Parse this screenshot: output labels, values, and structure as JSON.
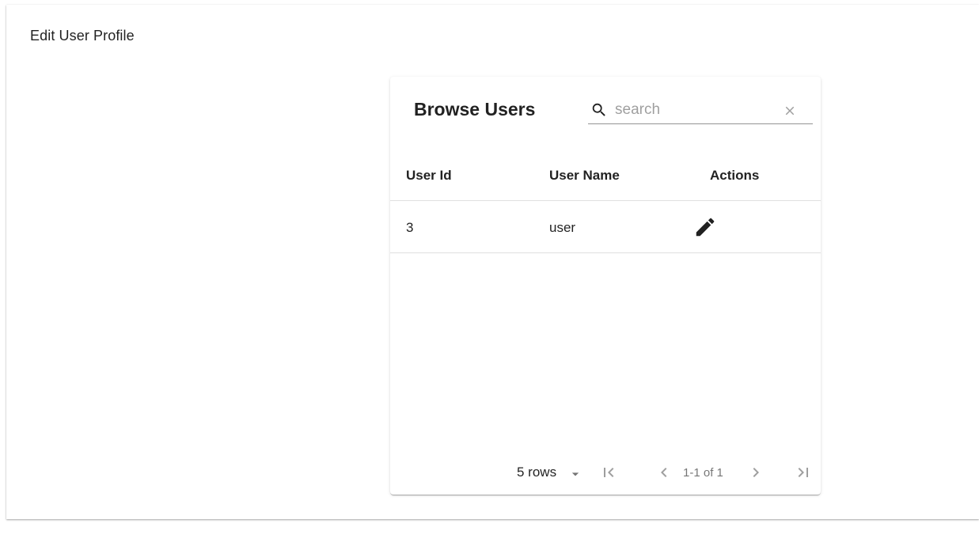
{
  "page": {
    "title": "Edit User Profile"
  },
  "table": {
    "title": "Browse Users",
    "search": {
      "placeholder": "search",
      "value": ""
    },
    "columns": [
      "User Id",
      "User Name",
      "Actions"
    ],
    "rows": [
      {
        "user_id": "3",
        "user_name": "user"
      }
    ],
    "pagination": {
      "rows_per_page": "5 rows",
      "range": "1-1 of 1"
    }
  },
  "icons": {
    "search": "search-icon",
    "clear": "close-icon",
    "edit": "pencil-icon",
    "rows_dropdown": "caret-down-icon",
    "first": "first-page-icon",
    "prev": "chevron-left-icon",
    "next": "chevron-right-icon",
    "last": "last-page-icon"
  }
}
